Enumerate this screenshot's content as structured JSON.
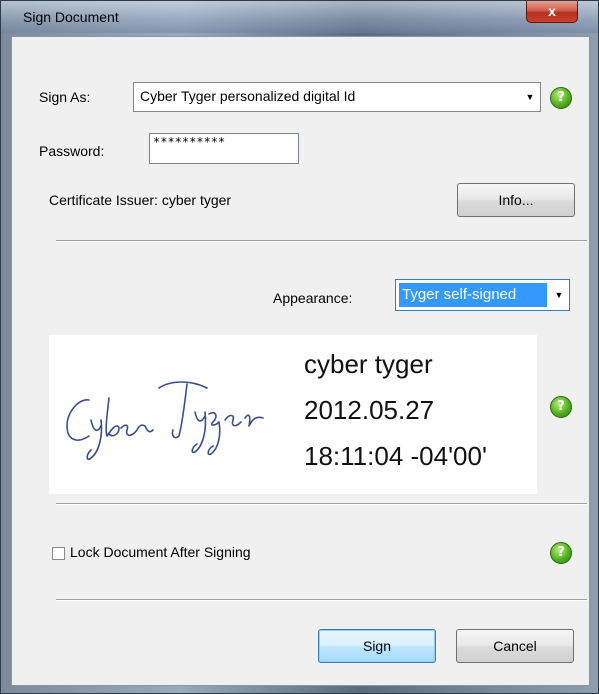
{
  "window": {
    "title": "Sign Document",
    "close_symbol": "x"
  },
  "sign_as": {
    "label": "Sign As:",
    "value": "Cyber Tyger personalized digital Id"
  },
  "password": {
    "label": "Password:",
    "value": "**********"
  },
  "certificate": {
    "label": "Certificate Issuer: cyber tyger"
  },
  "info_button": {
    "label": "Info..."
  },
  "appearance": {
    "label": "Appearance:",
    "value": "Tyger self-signed"
  },
  "signature_preview": {
    "handwritten": "Cyber Tyger",
    "name": "cyber tyger",
    "date": "2012.05.27",
    "time": "18:11:04 -04'00'"
  },
  "lock": {
    "label": "Lock Document After Signing",
    "checked": false
  },
  "buttons": {
    "sign": "Sign",
    "cancel": "Cancel"
  },
  "help": {
    "symbol": "?"
  },
  "colors": {
    "accent": "#3399ff",
    "help_green": "#52b020",
    "ink": "#3a4f8a"
  }
}
